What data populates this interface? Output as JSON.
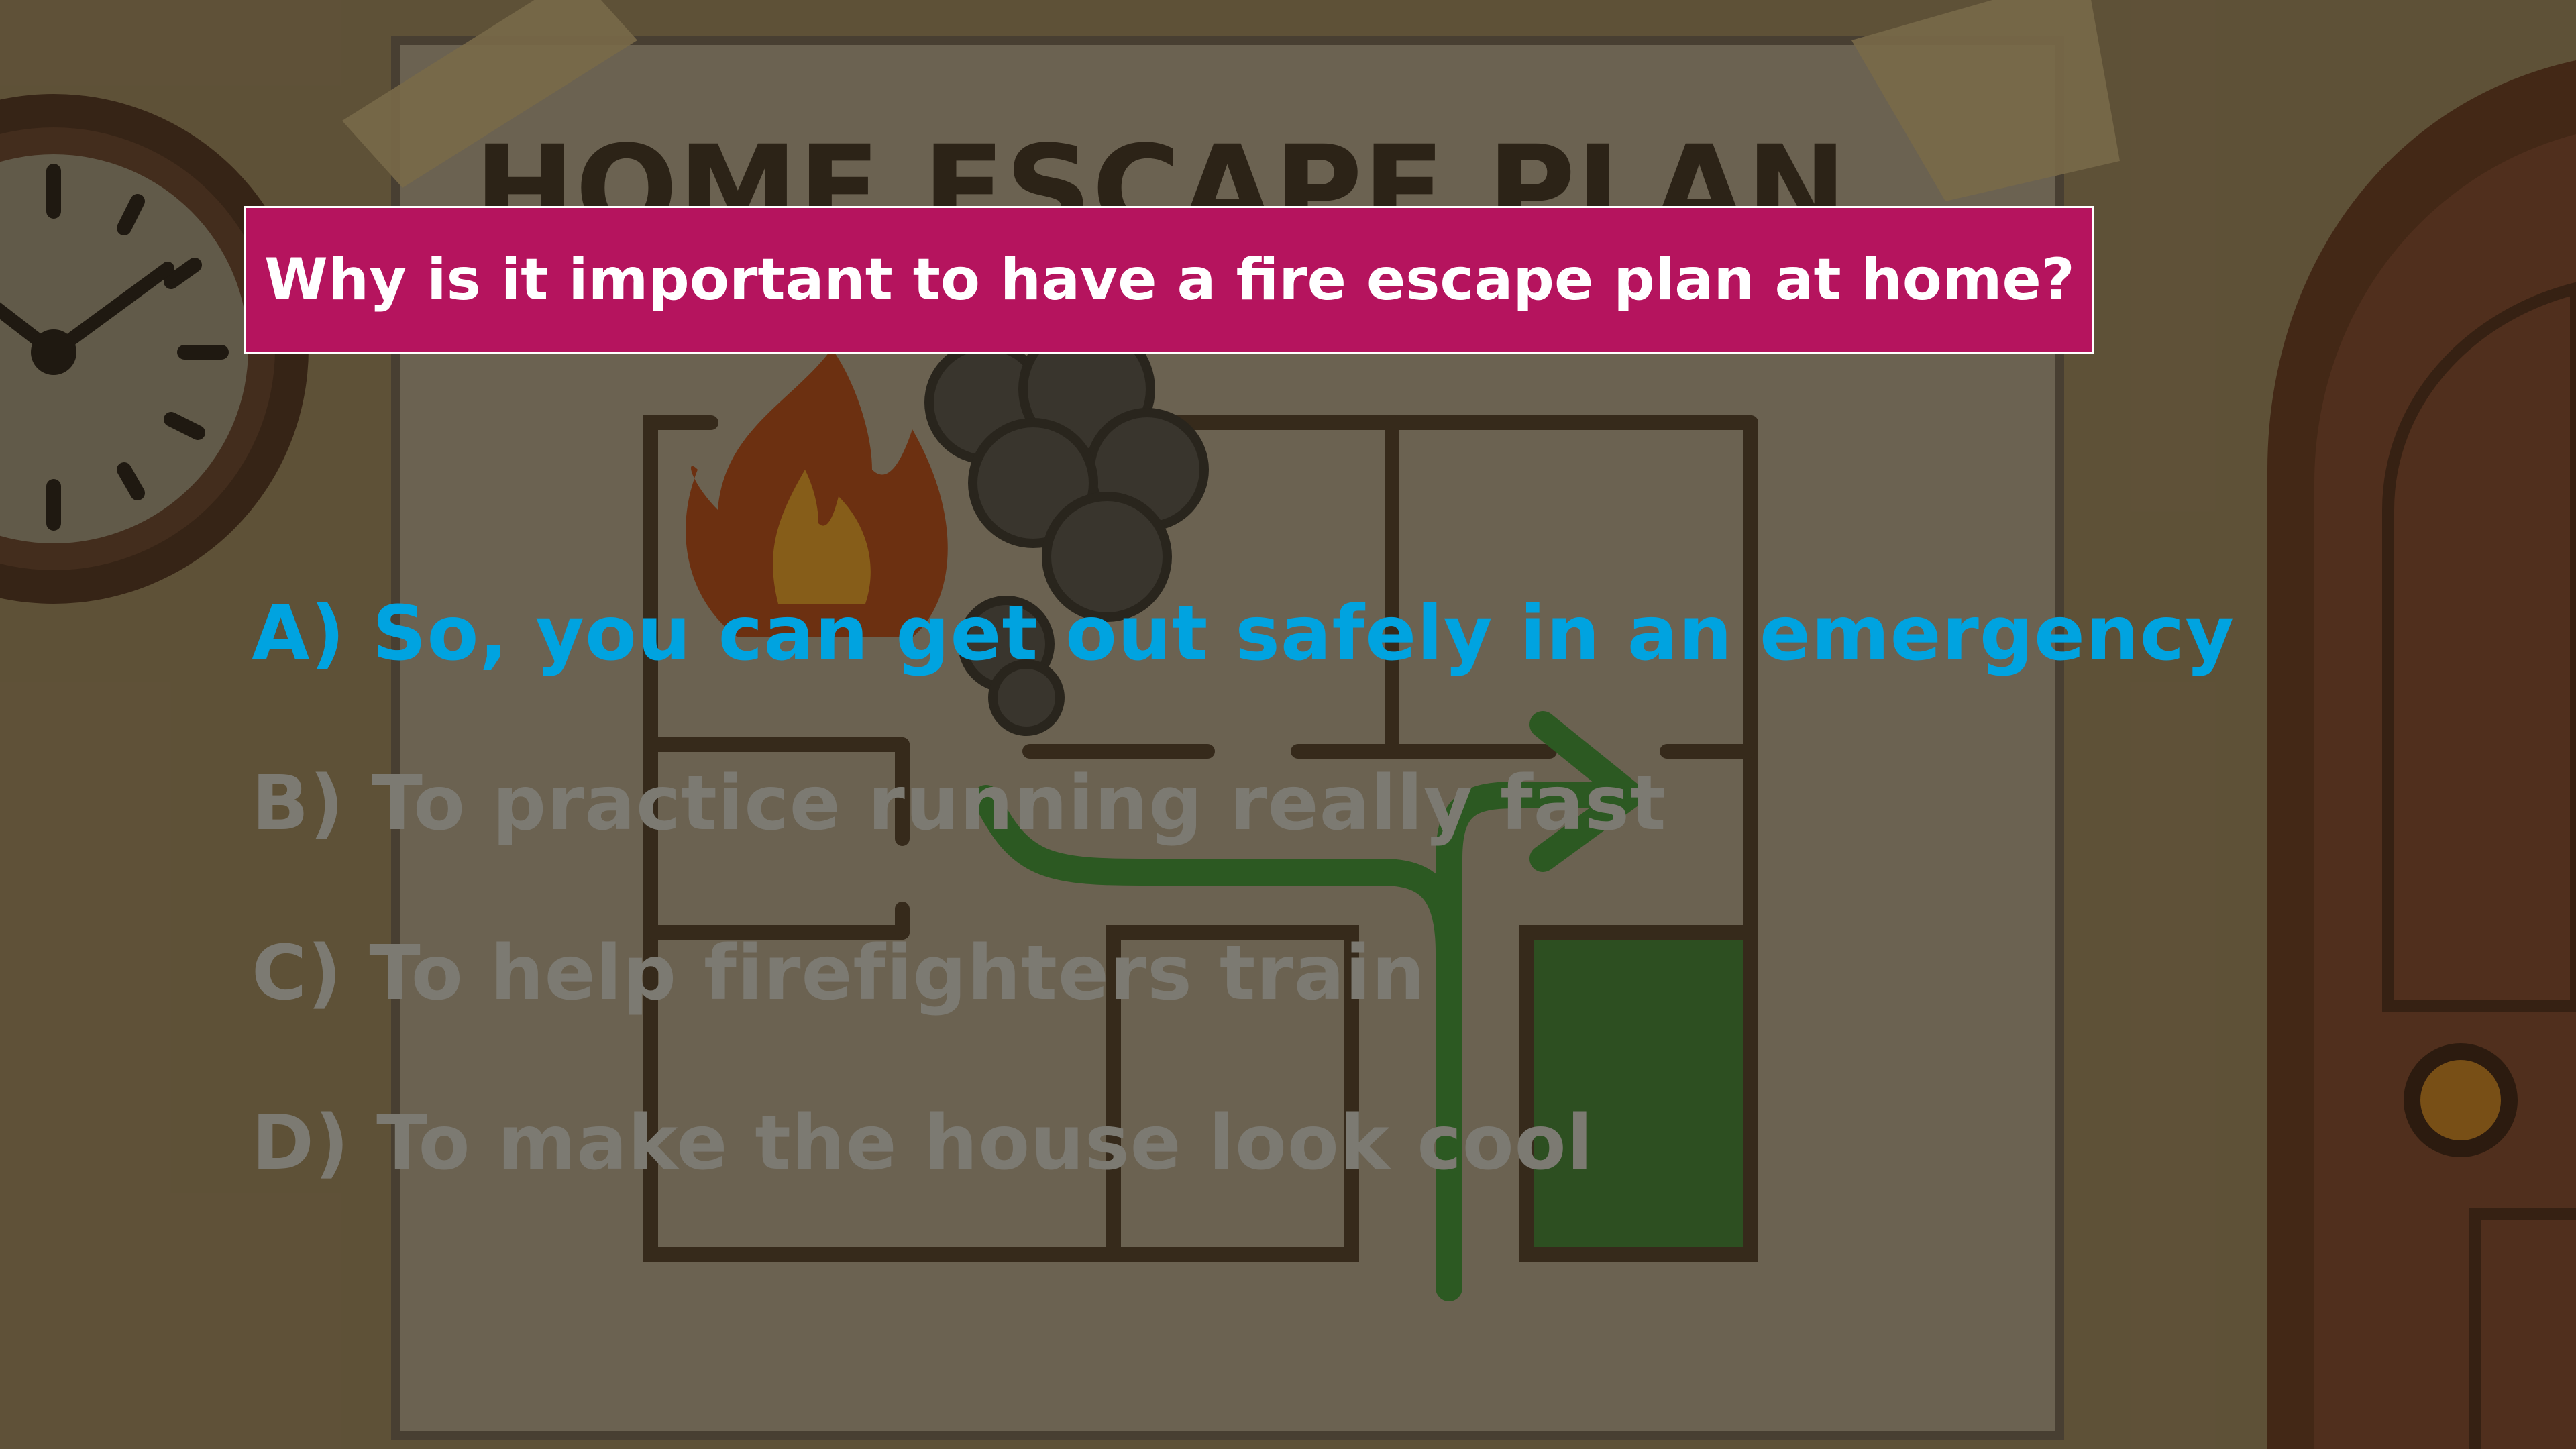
{
  "colors": {
    "question_bg": "#b5145e",
    "correct": "#00a3e0",
    "dimmed": "#7c7a72"
  },
  "question": {
    "text": "Why is it important to have a fire escape plan at home?"
  },
  "poster": {
    "title": "HOME ESCAPE PLAN"
  },
  "options": [
    {
      "label": "A) So, you can get out safely in an emergency",
      "state": "correct"
    },
    {
      "label": "B) To practice running really fast",
      "state": "dimmed"
    },
    {
      "label": "C) To help firefighters train",
      "state": "dimmed"
    },
    {
      "label": "D) To make the house look cool",
      "state": "dimmed"
    }
  ]
}
